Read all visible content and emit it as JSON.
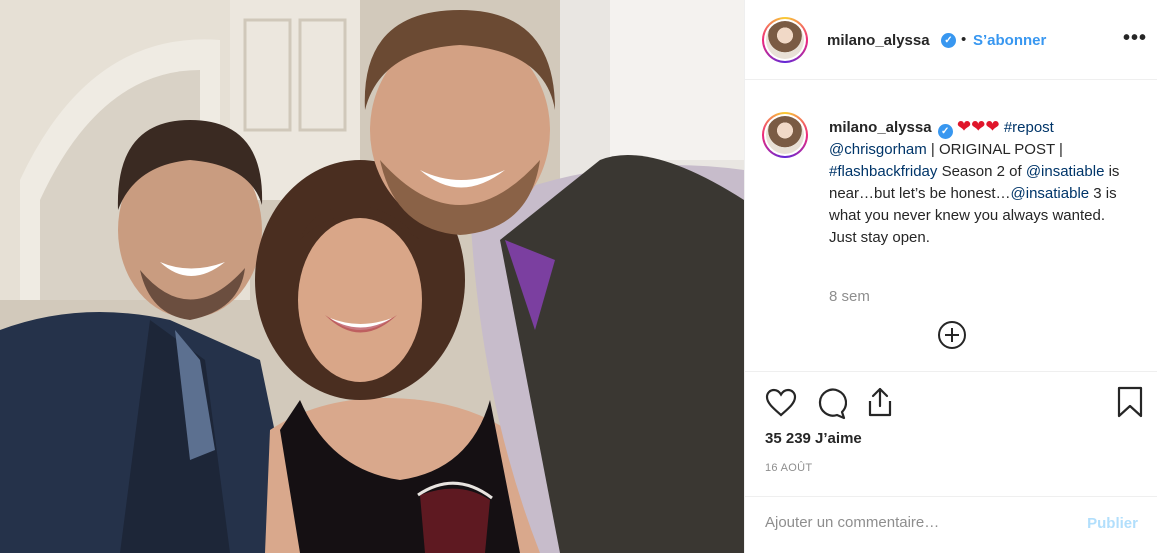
{
  "post": {
    "username": "milano_alyssa",
    "follow_separator": "•",
    "follow_label": "S’abonner",
    "more_label": "•••",
    "caption": {
      "username": "milano_alyssa",
      "hearts": "❤❤❤",
      "hashtag_repost": "#repost",
      "mention_chris": "@chrisgorham",
      "text1": " | ORIGINAL POST | ",
      "hashtag_flashback": "#flashbackfriday",
      "text2": " Season 2 of ",
      "mention_insatiable1": "@insatiable",
      "text3": " is near…but let’s be honest…",
      "mention_insatiable2": "@insatiable",
      "text4": " 3 is what you never knew you always wanted. Just stay open."
    },
    "time_ago": "8 sem",
    "likes": "35 239 J’aime",
    "date": "16 AOÛT",
    "comment_placeholder": "Ajouter un commentaire…",
    "publish_label": "Publier"
  },
  "icons": {
    "verified": "verified-badge-icon",
    "like": "heart-outline-icon",
    "comment": "comment-bubble-icon",
    "share": "share-icon",
    "save": "bookmark-icon",
    "more": "more-options-icon",
    "load_more": "plus-circle-icon"
  },
  "colors": {
    "link": "#003569",
    "accent": "#3897f0",
    "publish_disabled": "#b2dffc",
    "heart": "#e0162b"
  }
}
